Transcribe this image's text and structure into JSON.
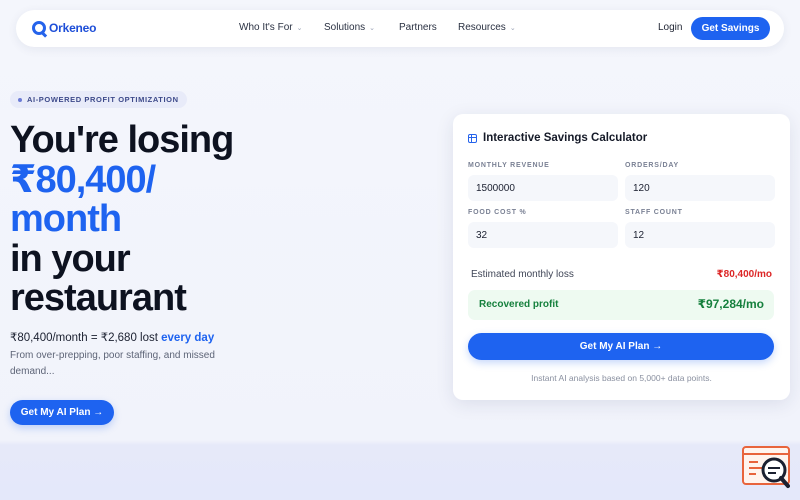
{
  "nav": {
    "logo": "Orkeneo",
    "items": [
      {
        "label": "Who It's For",
        "has_dropdown": true
      },
      {
        "label": "Solutions",
        "has_dropdown": true
      },
      {
        "label": "Partners",
        "has_dropdown": false
      },
      {
        "label": "Resources",
        "has_dropdown": true
      }
    ],
    "login": "Login",
    "cta": "Get Savings"
  },
  "hero": {
    "badge": "AI-POWERED PROFIT OPTIMIZATION",
    "title_line1": "You're losing",
    "title_amount": "₹80,400/",
    "title_month": "month",
    "title_line3": "in your",
    "title_line4": "restaurant",
    "subline_prefix": "₹80,400/month = ₹2,680 lost ",
    "subline_highlight": "every day",
    "description": "From over-prepping, poor staffing, and missed demand...",
    "cta": "Get My AI Plan →"
  },
  "calculator": {
    "title": "Interactive Savings Calculator",
    "fields": [
      {
        "label": "MONTHLY REVENUE",
        "value": "1500000"
      },
      {
        "label": "ORDERS/DAY",
        "value": "120"
      },
      {
        "label": "FOOD COST %",
        "value": "32"
      },
      {
        "label": "STAFF COUNT",
        "value": "12"
      }
    ],
    "estimated_label": "Estimated monthly loss",
    "estimated_value": "₹80,400/mo",
    "recovered_label": "Recovered profit",
    "recovered_value": "₹97,284/mo",
    "cta": "Get My AI Plan →",
    "footnote": "Instant AI analysis based on 5,000+ data points."
  },
  "colors": {
    "accent": "#1e63f0",
    "loss": "#dc2626",
    "profit": "#15803d",
    "widget": "#e8643c"
  },
  "icons": {
    "logo": "orkeneo-logo-icon",
    "calculator": "calculator-icon",
    "widget": "chat-search-widget-icon"
  }
}
